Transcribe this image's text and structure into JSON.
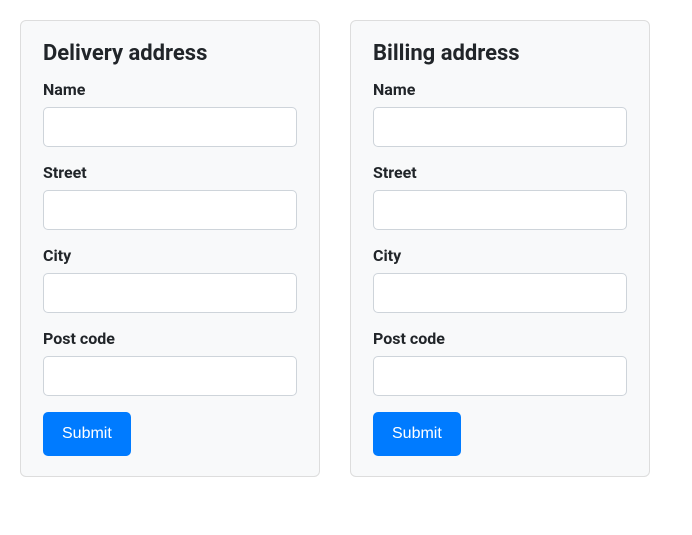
{
  "delivery": {
    "title": "Delivery address",
    "fields": {
      "name": {
        "label": "Name",
        "value": ""
      },
      "street": {
        "label": "Street",
        "value": ""
      },
      "city": {
        "label": "City",
        "value": ""
      },
      "postcode": {
        "label": "Post code",
        "value": ""
      }
    },
    "submit_label": "Submit"
  },
  "billing": {
    "title": "Billing address",
    "fields": {
      "name": {
        "label": "Name",
        "value": ""
      },
      "street": {
        "label": "Street",
        "value": ""
      },
      "city": {
        "label": "City",
        "value": ""
      },
      "postcode": {
        "label": "Post code",
        "value": ""
      }
    },
    "submit_label": "Submit"
  }
}
